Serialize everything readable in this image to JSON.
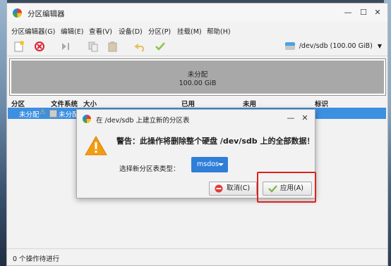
{
  "window": {
    "title": "分区编辑器"
  },
  "menu": [
    "分区编辑器(G)",
    "编辑(E)",
    "查看(V)",
    "设备(D)",
    "分区(P)",
    "挂载(M)",
    "帮助(H)"
  ],
  "device": {
    "label": "/dev/sdb (100.00 GiB)"
  },
  "disk_map": {
    "label": "未分配",
    "size": "100.00 GiB"
  },
  "table": {
    "headers": [
      "分区",
      "文件系统",
      "大小",
      "已用",
      "未用",
      "标识"
    ],
    "row": {
      "partition": "未分配",
      "filesystem": "未分配"
    }
  },
  "dialog": {
    "title": "在 /dev/sdb 上建立新的分区表",
    "warning": "警告：此操作将删除整个硬盘 /dev/sdb 上的全部数据！",
    "table_type_label": "选择新分区表类型：",
    "table_type_value": "msdos",
    "cancel_label": "取消(C)",
    "apply_label": "应用(A)"
  },
  "status": "0 个操作待进行",
  "colors": {
    "selection": "#3d8fe0",
    "dropdown": "#2f7ed8",
    "highlight": "#e0201c",
    "unallocated": "#a8a8a8"
  }
}
